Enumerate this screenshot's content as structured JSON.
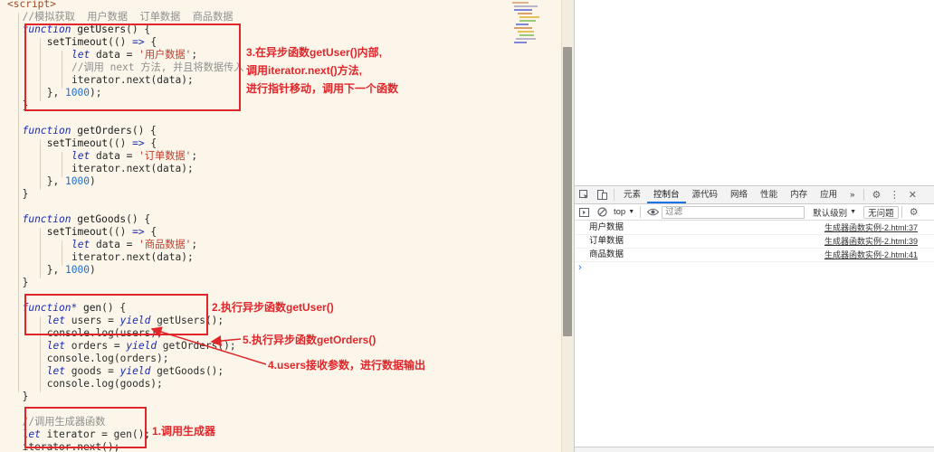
{
  "editor": {
    "lines": [
      {
        "tokens": [
          {
            "c": "tag",
            "t": "<script>"
          }
        ]
      },
      {
        "tokens": [
          {
            "c": "ind2",
            "t": ""
          },
          {
            "c": "cm",
            "t": "//模拟获取  用户数据  订单数据  商品数据"
          }
        ]
      },
      {
        "tokens": [
          {
            "c": "ind2",
            "t": ""
          },
          {
            "c": "kw",
            "t": "function"
          },
          {
            "c": "fn",
            "t": " getUsers"
          },
          {
            "c": "",
            "t": "() {"
          }
        ]
      },
      {
        "tokens": [
          {
            "c": "ind3",
            "t": ""
          },
          {
            "c": "fn",
            "t": "setTimeout"
          },
          {
            "c": "",
            "t": "(() "
          },
          {
            "c": "kw",
            "t": "=>"
          },
          {
            "c": "",
            "t": " {"
          }
        ]
      },
      {
        "tokens": [
          {
            "c": "ind4",
            "t": ""
          },
          {
            "c": "kw",
            "t": "let"
          },
          {
            "c": "",
            "t": " data = "
          },
          {
            "c": "str",
            "t": "'用户数据'"
          },
          {
            "c": "",
            "t": ";"
          }
        ]
      },
      {
        "tokens": [
          {
            "c": "ind4",
            "t": ""
          },
          {
            "c": "cm",
            "t": "//调用 next 方法, 并且将数据传入"
          }
        ]
      },
      {
        "tokens": [
          {
            "c": "ind4",
            "t": ""
          },
          {
            "c": "",
            "t": "iterator.next(data);"
          }
        ]
      },
      {
        "tokens": [
          {
            "c": "ind3",
            "t": ""
          },
          {
            "c": "",
            "t": "}, "
          },
          {
            "c": "num",
            "t": "1000"
          },
          {
            "c": "",
            "t": ");"
          }
        ]
      },
      {
        "tokens": [
          {
            "c": "ind2",
            "t": ""
          },
          {
            "c": "",
            "t": "}"
          }
        ]
      },
      {
        "tokens": []
      },
      {
        "tokens": [
          {
            "c": "ind2",
            "t": ""
          },
          {
            "c": "kw",
            "t": "function"
          },
          {
            "c": "fn",
            "t": " getOrders"
          },
          {
            "c": "",
            "t": "() {"
          }
        ]
      },
      {
        "tokens": [
          {
            "c": "ind3",
            "t": ""
          },
          {
            "c": "fn",
            "t": "setTimeout"
          },
          {
            "c": "",
            "t": "(() "
          },
          {
            "c": "kw",
            "t": "=>"
          },
          {
            "c": "",
            "t": " {"
          }
        ]
      },
      {
        "tokens": [
          {
            "c": "ind4",
            "t": ""
          },
          {
            "c": "kw",
            "t": "let"
          },
          {
            "c": "",
            "t": " data = "
          },
          {
            "c": "str",
            "t": "'订单数据'"
          },
          {
            "c": "",
            "t": ";"
          }
        ]
      },
      {
        "tokens": [
          {
            "c": "ind4",
            "t": ""
          },
          {
            "c": "",
            "t": "iterator.next(data);"
          }
        ]
      },
      {
        "tokens": [
          {
            "c": "ind3",
            "t": ""
          },
          {
            "c": "",
            "t": "}, "
          },
          {
            "c": "num",
            "t": "1000"
          },
          {
            "c": "",
            "t": ")"
          }
        ]
      },
      {
        "tokens": [
          {
            "c": "ind2",
            "t": ""
          },
          {
            "c": "",
            "t": "}"
          }
        ]
      },
      {
        "tokens": []
      },
      {
        "tokens": [
          {
            "c": "ind2",
            "t": ""
          },
          {
            "c": "kw",
            "t": "function"
          },
          {
            "c": "fn",
            "t": " getGoods"
          },
          {
            "c": "",
            "t": "() {"
          }
        ]
      },
      {
        "tokens": [
          {
            "c": "ind3",
            "t": ""
          },
          {
            "c": "fn",
            "t": "setTimeout"
          },
          {
            "c": "",
            "t": "(() "
          },
          {
            "c": "kw",
            "t": "=>"
          },
          {
            "c": "",
            "t": " {"
          }
        ]
      },
      {
        "tokens": [
          {
            "c": "ind4",
            "t": ""
          },
          {
            "c": "kw",
            "t": "let"
          },
          {
            "c": "",
            "t": " data = "
          },
          {
            "c": "str",
            "t": "'商品数据'"
          },
          {
            "c": "",
            "t": ";"
          }
        ]
      },
      {
        "tokens": [
          {
            "c": "ind4",
            "t": ""
          },
          {
            "c": "",
            "t": "iterator.next(data);"
          }
        ]
      },
      {
        "tokens": [
          {
            "c": "ind3",
            "t": ""
          },
          {
            "c": "",
            "t": "}, "
          },
          {
            "c": "num",
            "t": "1000"
          },
          {
            "c": "",
            "t": ")"
          }
        ]
      },
      {
        "tokens": [
          {
            "c": "ind2",
            "t": ""
          },
          {
            "c": "",
            "t": "}"
          }
        ]
      },
      {
        "tokens": []
      },
      {
        "tokens": [
          {
            "c": "ind2",
            "t": ""
          },
          {
            "c": "kw",
            "t": "function*"
          },
          {
            "c": "fn",
            "t": " gen"
          },
          {
            "c": "",
            "t": "() {"
          }
        ]
      },
      {
        "tokens": [
          {
            "c": "ind3",
            "t": ""
          },
          {
            "c": "kw",
            "t": "let"
          },
          {
            "c": "",
            "t": " users = "
          },
          {
            "c": "kw",
            "t": "yield"
          },
          {
            "c": "",
            "t": " getUsers();"
          }
        ]
      },
      {
        "tokens": [
          {
            "c": "ind3",
            "t": ""
          },
          {
            "c": "",
            "t": "console.log(users);"
          }
        ]
      },
      {
        "tokens": [
          {
            "c": "ind3",
            "t": ""
          },
          {
            "c": "kw",
            "t": "let"
          },
          {
            "c": "",
            "t": " orders = "
          },
          {
            "c": "kw",
            "t": "yield"
          },
          {
            "c": "",
            "t": " getOrders();"
          }
        ]
      },
      {
        "tokens": [
          {
            "c": "ind3",
            "t": ""
          },
          {
            "c": "",
            "t": "console.log(orders);"
          }
        ]
      },
      {
        "tokens": [
          {
            "c": "ind3",
            "t": ""
          },
          {
            "c": "kw",
            "t": "let"
          },
          {
            "c": "",
            "t": " goods = "
          },
          {
            "c": "kw",
            "t": "yield"
          },
          {
            "c": "",
            "t": " getGoods();"
          }
        ]
      },
      {
        "tokens": [
          {
            "c": "ind3",
            "t": ""
          },
          {
            "c": "",
            "t": "console.log(goods);"
          }
        ]
      },
      {
        "tokens": [
          {
            "c": "ind2",
            "t": ""
          },
          {
            "c": "",
            "t": "}"
          }
        ]
      },
      {
        "tokens": []
      },
      {
        "tokens": [
          {
            "c": "ind2",
            "t": ""
          },
          {
            "c": "cm",
            "t": "//调用生成器函数"
          }
        ]
      },
      {
        "tokens": [
          {
            "c": "ind2",
            "t": ""
          },
          {
            "c": "kw",
            "t": "let"
          },
          {
            "c": "",
            "t": " iterator = gen();"
          }
        ]
      },
      {
        "tokens": [
          {
            "c": "ind2",
            "t": ""
          },
          {
            "c": "",
            "t": "iterator.next();"
          }
        ]
      }
    ]
  },
  "annotations": {
    "step3_line1": "3.在异步函数getUser()内部,",
    "step3_line2": "调用iterator.next()方法,",
    "step3_line3": "进行指针移动，调用下一个函数",
    "step2": "2.执行异步函数getUser()",
    "step5": "5.执行异步函数getOrders()",
    "step4": "4.users接收参数，进行数据输出",
    "step1": "1.调用生成器"
  },
  "devtools": {
    "tabs": [
      {
        "label": "元素"
      },
      {
        "label": "控制台",
        "active": true
      },
      {
        "label": "源代码"
      },
      {
        "label": "网络"
      },
      {
        "label": "性能"
      },
      {
        "label": "内存"
      },
      {
        "label": "应用"
      }
    ],
    "more_tabs": "»",
    "context": "top",
    "filter_placeholder": "过滤",
    "levels": "默认级别",
    "issues": "无问题",
    "messages": [
      {
        "text": "用户数据",
        "source": "生成器函数实例-2.html:37"
      },
      {
        "text": "订单数据",
        "source": "生成器函数实例-2.html:39"
      },
      {
        "text": "商品数据",
        "source": "生成器函数实例-2.html:41"
      }
    ],
    "prompt": "›"
  },
  "colors": {
    "annotation": "#e0262b",
    "editor_bg": "#fbf6e9",
    "keyword": "#1b2bb3",
    "string": "#c03a2b",
    "comment": "#8f8f8f",
    "number": "#1d6fd1",
    "active_tab": "#1a73e8"
  }
}
